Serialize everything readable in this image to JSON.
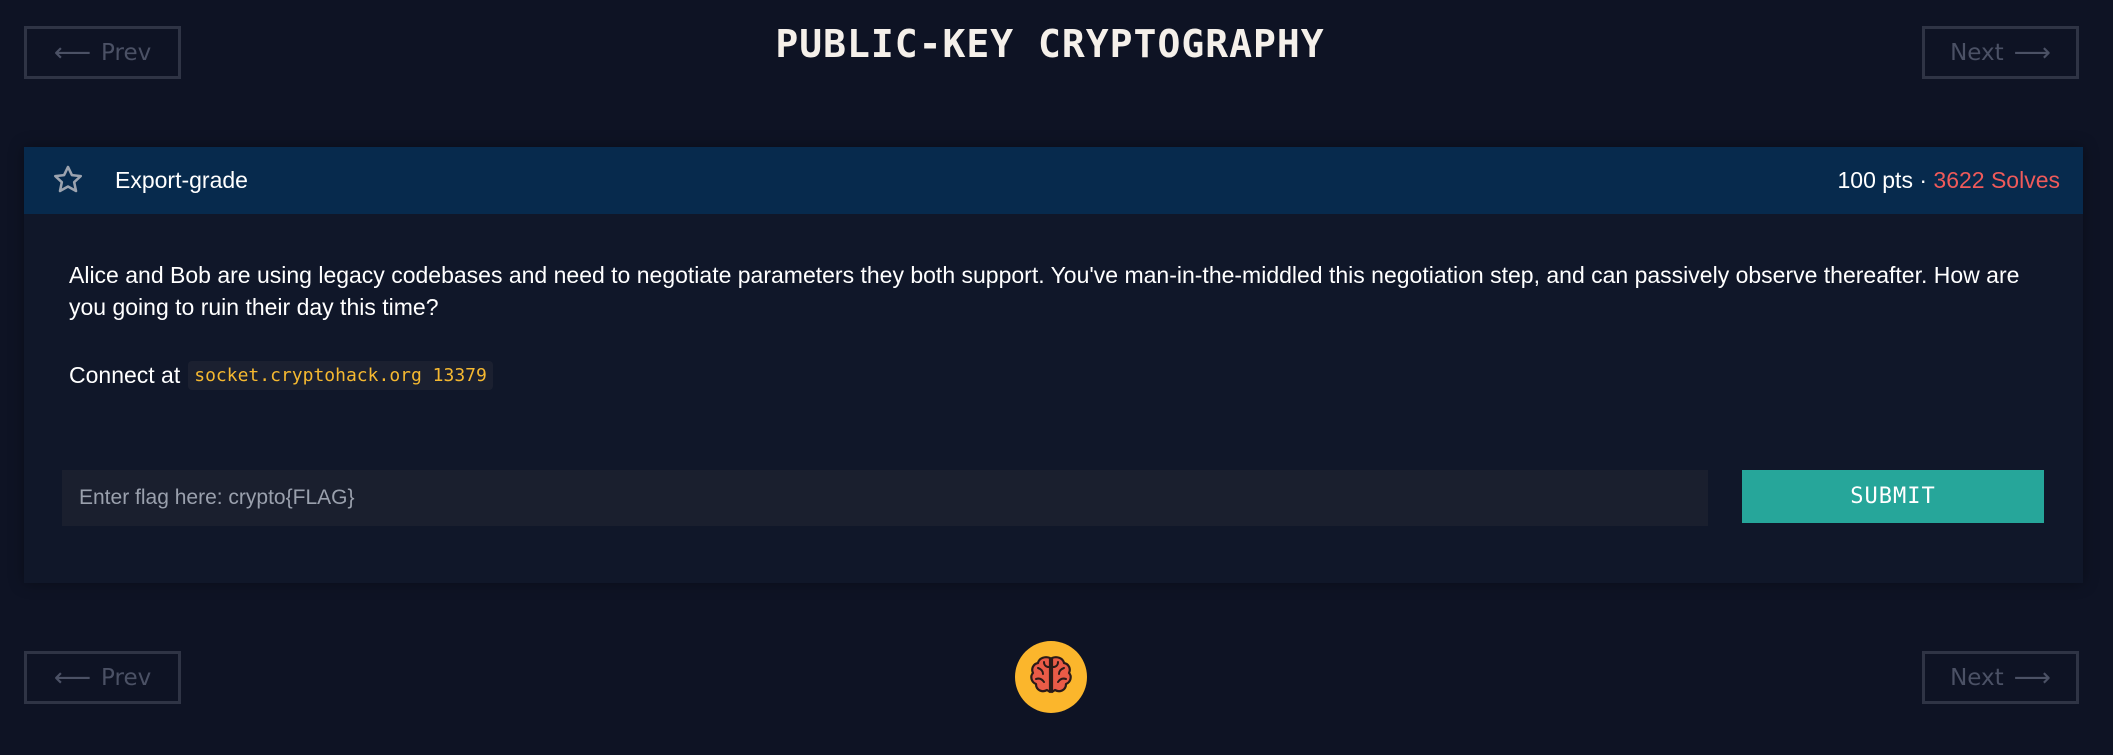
{
  "page": {
    "title": "PUBLIC-KEY CRYPTOGRAPHY"
  },
  "nav": {
    "prev_arrow": "⟵",
    "prev_label": "Prev",
    "next_label": "Next",
    "next_arrow": "⟶"
  },
  "challenge": {
    "name": "Export-grade",
    "points": "100",
    "points_unit": "pts",
    "separator": "·",
    "solves": "3622 Solves",
    "description": "Alice and Bob are using legacy codebases and need to negotiate parameters they both support. You've man-in-the-middled this negotiation step, and can passively observe thereafter. How are you going to ruin their day this time?",
    "connect_prefix": "Connect at",
    "connect_address": "socket.cryptohack.org 13379"
  },
  "flag_form": {
    "placeholder": "Enter flag here: crypto{FLAG}",
    "value": "",
    "submit_label": "SUBMIT"
  },
  "icons": {
    "star": "star-icon",
    "brain": "brain-icon",
    "prev": "left-arrow-icon",
    "next": "right-arrow-icon"
  },
  "colors": {
    "background": "#0e1324",
    "header": "#072a4d",
    "solves": "#ef5a5a",
    "code": "#f5b830",
    "submit": "#26a69a",
    "brain_badge": "#fbb62c"
  }
}
